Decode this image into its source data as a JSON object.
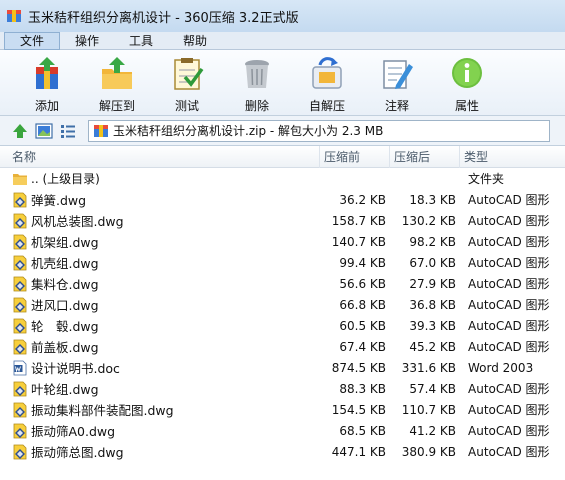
{
  "window": {
    "title": "玉米秸秆组织分离机设计 - 360压缩 3.2正式版"
  },
  "menu": [
    {
      "label": "文件",
      "active": true
    },
    {
      "label": "操作",
      "active": false
    },
    {
      "label": "工具",
      "active": false
    },
    {
      "label": "帮助",
      "active": false
    }
  ],
  "toolbar": [
    {
      "label": "添加",
      "icon": "add-archive-icon"
    },
    {
      "label": "解压到",
      "icon": "extract-to-icon"
    },
    {
      "label": "测试",
      "icon": "test-checklist-icon"
    },
    {
      "label": "删除",
      "icon": "trash-can-icon"
    },
    {
      "label": "自解压",
      "icon": "self-extract-icon"
    },
    {
      "label": "注释",
      "icon": "comment-pencil-icon"
    },
    {
      "label": "属性",
      "icon": "info-icon"
    }
  ],
  "address": {
    "path": "玉米秸秆组织分离机设计.zip - 解包大小为 2.3 MB"
  },
  "columns": {
    "name": "名称",
    "compressed": "压缩前",
    "original": "压缩后",
    "type": "类型"
  },
  "files": [
    {
      "name": ".. (上级目录)",
      "compressed": "",
      "original": "",
      "type": "文件夹",
      "icon": "folder-icon"
    },
    {
      "name": "弹簧.dwg",
      "compressed": "36.2 KB",
      "original": "18.3 KB",
      "type": "AutoCAD 图形",
      "icon": "dwg-file-icon"
    },
    {
      "name": "风机总装图.dwg",
      "compressed": "158.7 KB",
      "original": "130.2 KB",
      "type": "AutoCAD 图形",
      "icon": "dwg-file-icon"
    },
    {
      "name": "机架组.dwg",
      "compressed": "140.7 KB",
      "original": "98.2 KB",
      "type": "AutoCAD 图形",
      "icon": "dwg-file-icon"
    },
    {
      "name": "机壳组.dwg",
      "compressed": "99.4 KB",
      "original": "67.0 KB",
      "type": "AutoCAD 图形",
      "icon": "dwg-file-icon"
    },
    {
      "name": "集料仓.dwg",
      "compressed": "56.6 KB",
      "original": "27.9 KB",
      "type": "AutoCAD 图形",
      "icon": "dwg-file-icon"
    },
    {
      "name": "进风口.dwg",
      "compressed": "66.8 KB",
      "original": "36.8 KB",
      "type": "AutoCAD 图形",
      "icon": "dwg-file-icon"
    },
    {
      "name": "轮　毂.dwg",
      "compressed": "60.5 KB",
      "original": "39.3 KB",
      "type": "AutoCAD 图形",
      "icon": "dwg-file-icon"
    },
    {
      "name": "前盖板.dwg",
      "compressed": "67.4 KB",
      "original": "45.2 KB",
      "type": "AutoCAD 图形",
      "icon": "dwg-file-icon"
    },
    {
      "name": "设计说明书.doc",
      "compressed": "874.5 KB",
      "original": "331.6 KB",
      "type": "Word 2003",
      "icon": "word-doc-icon"
    },
    {
      "name": "叶轮组.dwg",
      "compressed": "88.3 KB",
      "original": "57.4 KB",
      "type": "AutoCAD 图形",
      "icon": "dwg-file-icon"
    },
    {
      "name": "振动集料部件装配图.dwg",
      "compressed": "154.5 KB",
      "original": "110.7 KB",
      "type": "AutoCAD 图形",
      "icon": "dwg-file-icon"
    },
    {
      "name": "振动筛A0.dwg",
      "compressed": "68.5 KB",
      "original": "41.2 KB",
      "type": "AutoCAD 图形",
      "icon": "dwg-file-icon"
    },
    {
      "name": "振动筛总图.dwg",
      "compressed": "447.1 KB",
      "original": "380.9 KB",
      "type": "AutoCAD 图形",
      "icon": "dwg-file-icon"
    }
  ]
}
